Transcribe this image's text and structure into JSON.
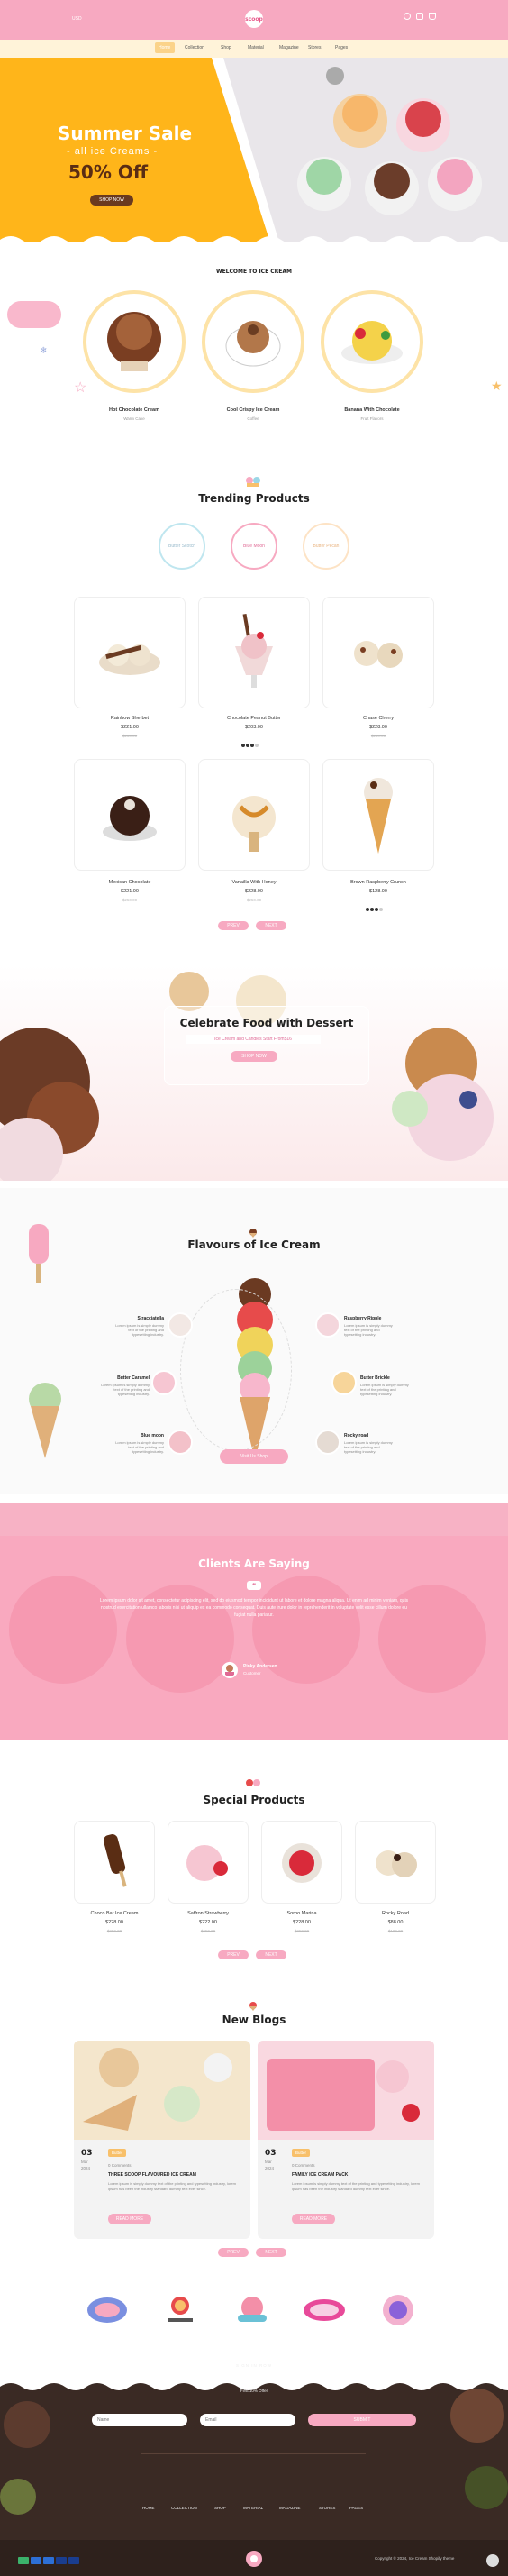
{
  "header": {
    "currency": "USD",
    "nav": [
      "Home",
      "Collection",
      "Shop",
      "Material",
      "Magazine",
      "Stores",
      "Pages"
    ]
  },
  "hero": {
    "title": "Summer Sale",
    "subtitle": "- all ice Creams -",
    "discount": "50% Off",
    "button": "SHOP NOW"
  },
  "welcome": {
    "title": "WELCOME TO ICE CREAM",
    "items": [
      {
        "name": "Hot Chocolate Cream",
        "sub": "Warm Cake"
      },
      {
        "name": "Cool Crispy Ice Cream",
        "sub": "Coffee"
      },
      {
        "name": "Banana With Chocolate",
        "sub": "Fruit Flavors"
      }
    ]
  },
  "trending": {
    "title": "Trending Products",
    "tabs": [
      "Butter Scotch",
      "Blue Moon",
      "Butter Pecan"
    ],
    "products": [
      {
        "name": "Rainbow Sherbet",
        "price": "$221.00",
        "old": "$250.00"
      },
      {
        "name": "Chocolate Peanut Butter",
        "price": "$203.00",
        "old": ""
      },
      {
        "name": "Chase Cherry",
        "price": "$228.00",
        "old": "$250.00"
      },
      {
        "name": "Mexican Chocolate",
        "price": "$221.00",
        "old": "$250.00"
      },
      {
        "name": "Vanailla With Honey",
        "price": "$228.00",
        "old": "$250.00"
      },
      {
        "name": "Brown Raspberry Crunch",
        "price": "$128.00",
        "old": "$150.00"
      }
    ],
    "prev": "PREV",
    "next": "NEXT"
  },
  "promo": {
    "title": "Celebrate Food with Dessert",
    "sub": "Ice Cream and Candies Start From$16",
    "button": "SHOP NOW"
  },
  "flavours": {
    "title": "Flavours of Ice Cream",
    "left": [
      {
        "name": "Stracciatella",
        "text": "Lorem ipsum is simply dummy text of the printing and typesetting industry."
      },
      {
        "name": "Butter Caramel",
        "text": "Lorem ipsum is simply dummy text of the printing and typesetting industry."
      },
      {
        "name": "Blue moon",
        "text": "Lorem ipsum is simply dummy text of the printing and typesetting industry."
      }
    ],
    "right": [
      {
        "name": "Raspberry Ripple",
        "text": "Lorem ipsum is simply dummy text of the printing and typesetting industry."
      },
      {
        "name": "Butter Brickle",
        "text": "Lorem ipsum is simply dummy text of the printing and typesetting industry."
      },
      {
        "name": "Rocky road",
        "text": "Lorem ipsum is simply dummy text of the printing and typesetting industry."
      }
    ],
    "button": "Visit Us Shop"
  },
  "testimonial": {
    "title": "Clients Are Saying",
    "text": "Lorem ipsum dolor sit amet, consectetur adipiscing elit, sed do eiusmod tempor incididunt ut labore et dolore magna aliqua. Ut enim ad minim veniam, quis nostrud exercitation ullamco laboris nisi ut aliquip ex ea commodo consequat. Duis aute irure dolor in reprehenderit in voluptate velit esse cillum dolore eu fugiat nulla pariatur.",
    "author": "Pinky Andersen",
    "role": "Customer"
  },
  "special": {
    "title": "Special Products",
    "products": [
      {
        "name": "Choco Bar Ice Cream",
        "price": "$228.00",
        "old": "$250.00"
      },
      {
        "name": "Saffron Strawberry",
        "price": "$222.00",
        "old": "$250.00"
      },
      {
        "name": "Sorbo Marina",
        "price": "$228.00",
        "old": "$250.00"
      },
      {
        "name": "Rocky Road",
        "price": "$88.00",
        "old": "$100.00"
      }
    ]
  },
  "blogs": {
    "title": "New Blogs",
    "posts": [
      {
        "day": "03",
        "month": "Mar",
        "year": "2024",
        "tag": "Butter",
        "comments": "0 Comments",
        "title": "THREE SCOOP FLAVOURED ICE CREAM",
        "text": "Lorem ipsum is simply dummy text of the printing and typesetting industry, lorem ipsum has been the industry standard dummy text ever since.",
        "button": "READ MORE"
      },
      {
        "day": "03",
        "month": "Mar",
        "year": "2024",
        "tag": "Butter",
        "comments": "0 Comments",
        "title": "FAMILY ICE CREAM PACK",
        "text": "Lorem ipsum is simply dummy text of the printing and typesetting industry, lorem ipsum has been the industry standard dummy text ever since.",
        "button": "READ MORE"
      }
    ]
  },
  "brands": [
    "Brand 1",
    "Brand 2",
    "Brand 3",
    "Brand 4",
    "Brand 5"
  ],
  "newsletter": {
    "eyebrow": "SIGN IN ROW",
    "title": "Choose your Ice Cream",
    "sub": "First 10% Offer",
    "name_placeholder": "Name",
    "email_placeholder": "Email",
    "button": "SUBMIT"
  },
  "footer": {
    "links": [
      "HOME",
      "COLLECTION",
      "SHOP",
      "MATERIAL",
      "MAGAZINE",
      "STORES",
      "PAGES"
    ],
    "copyright": "Copyright © 2024, Ice Cream Shopify theme"
  },
  "colors": {
    "pink": "#f7a9c1",
    "yellow": "#ffb51a",
    "dark": "#3a2a24"
  }
}
